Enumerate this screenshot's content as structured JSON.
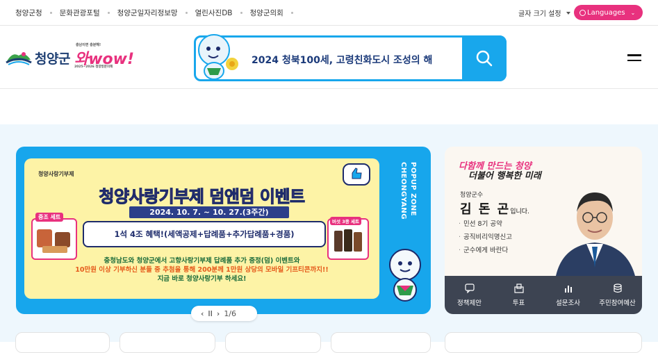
{
  "top_links": [
    "청양군청",
    "문화관광포털",
    "청양군일자리정보망",
    "열린사진DB",
    "청양군의회"
  ],
  "font_size_label": "글자 크기 설정",
  "languages_label": "Languages",
  "logo": {
    "name": "청양군",
    "wow": "와wow!",
    "tagline": "충남이면 충분해!",
    "sub": "2025~2026 청양방문의해"
  },
  "search": {
    "banner_text": "2024 청북100세, 고령친화도시 조성의 해"
  },
  "banner": {
    "brand": "청양사랑기부제",
    "title": "청양사랑기부제 덤앤덤 이벤트",
    "date": "2024. 10. 7. ~ 10. 27.(3주간)",
    "box": "1석 4조 혜택!(세액공제+답례품+추가답례품+경품)",
    "desc_line1": "충청남도와 청양군에서 고향사랑기부제 답례품 추가 증정(덤) 이벤트와",
    "desc_line2": "10만원 이상 기부하신 분들 중 추첨을 통해 200분께 1만원 상당의 모바일 기프티콘까지!!",
    "desc_line3": "지금 바로 청양사랑기부 하세요!",
    "gift_left": "중조 세트",
    "gift_right": "버섯 3종 세트",
    "side_label_1": "POPUP ZONE",
    "side_label_2": "CHEONGYANG"
  },
  "pager": {
    "prev": "‹",
    "pause": "II",
    "next": "›",
    "count": "1/6"
  },
  "mayor": {
    "slogan_1": "다함께 만드는 청양",
    "slogan_2": "더불어 행복한 미래",
    "role": "청양군수",
    "name": "김 돈 곤",
    "name_suffix": "입니다.",
    "links": [
      "민선 8기 공약",
      "공직비리익명신고",
      "군수에게 바란다"
    ],
    "bar": [
      "정책제안",
      "투표",
      "설문조사",
      "주민참여예산"
    ]
  }
}
